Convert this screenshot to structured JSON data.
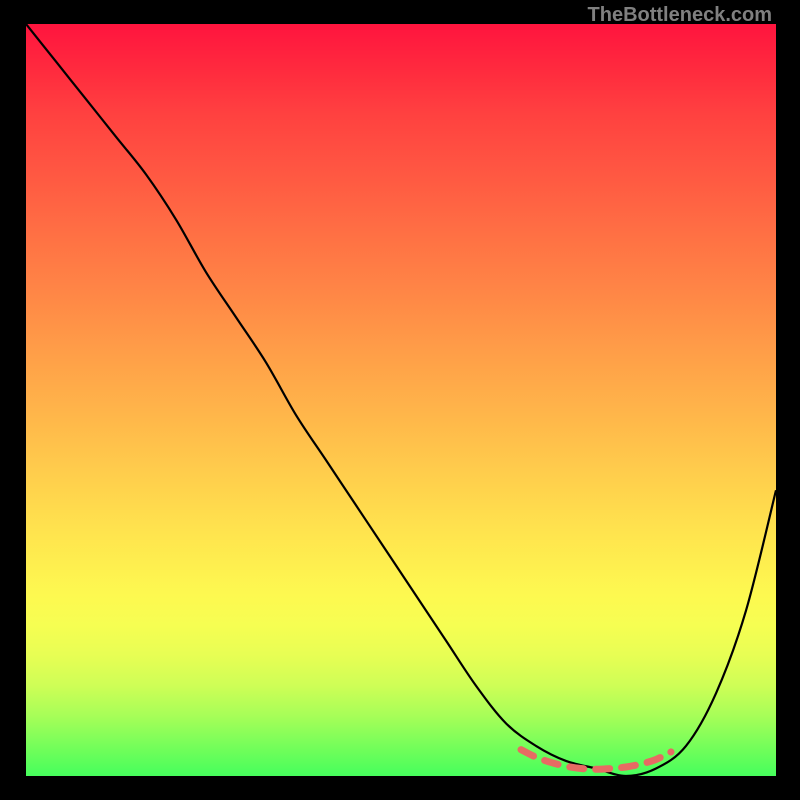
{
  "watermark": "TheBottleneck.com",
  "chart_data": {
    "type": "line",
    "title": "",
    "xlabel": "",
    "ylabel": "",
    "xlim": [
      0,
      100
    ],
    "ylim": [
      0,
      100
    ],
    "background_gradient": {
      "top_color": "#ff143e",
      "bottom_color": "#46fe5c",
      "description": "vertical rainbow gradient red→orange→yellow→green"
    },
    "series": [
      {
        "name": "main-curve",
        "color": "#000000",
        "x": [
          0,
          4,
          8,
          12,
          16,
          20,
          24,
          28,
          32,
          36,
          40,
          44,
          48,
          52,
          56,
          60,
          64,
          68,
          72,
          76,
          80,
          84,
          88,
          92,
          96,
          100
        ],
        "y": [
          100,
          95,
          90,
          85,
          80,
          74,
          67,
          61,
          55,
          48,
          42,
          36,
          30,
          24,
          18,
          12,
          7,
          4,
          2,
          1,
          0,
          1,
          4,
          11,
          22,
          38
        ]
      },
      {
        "name": "highlight-dashed",
        "color": "#e76b63",
        "style": "dashed",
        "x": [
          66,
          68,
          70,
          72,
          74,
          76,
          78,
          80,
          82,
          84,
          86
        ],
        "y": [
          3.5,
          2.5,
          1.8,
          1.3,
          1.0,
          0.9,
          1.0,
          1.2,
          1.6,
          2.2,
          3.2
        ]
      }
    ],
    "annotations": []
  }
}
